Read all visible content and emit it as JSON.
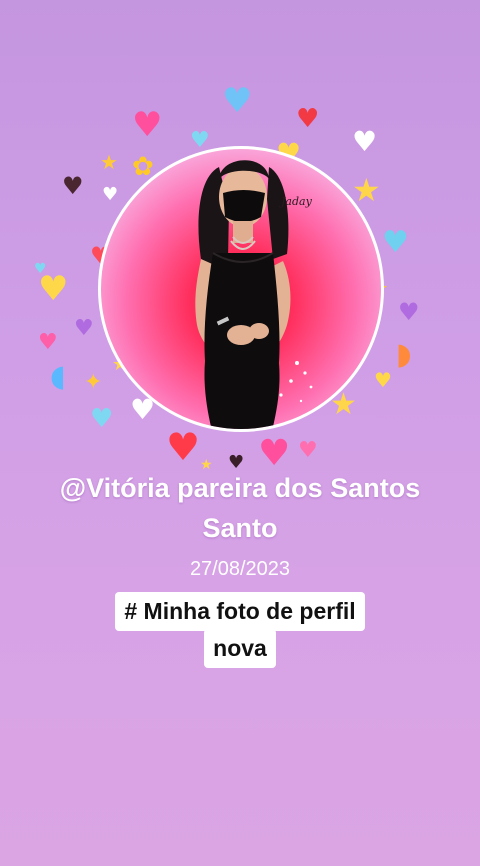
{
  "profile": {
    "handle_line1": "@Vitória pareira dos Santos",
    "handle_line2": "Santo",
    "date": "27/08/2023",
    "caption_line1": "# Minha foto de perfil",
    "caption_line2": "nova"
  },
  "avatar": {
    "signature": "Jaday"
  },
  "colors": {
    "background_top": "#c596e0",
    "background_bottom": "#dba5e3",
    "avatar_center": "#f0233c",
    "ring": "#ffffff"
  }
}
